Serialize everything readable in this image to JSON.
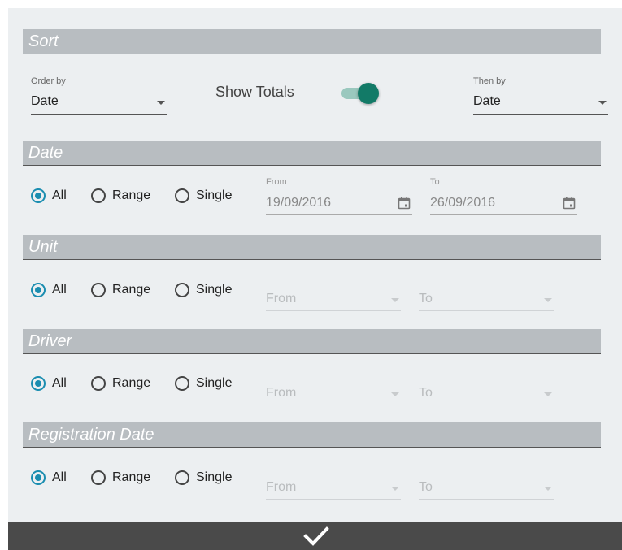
{
  "sort": {
    "header": "Sort",
    "order_by_label": "Order by",
    "order_by_value": "Date",
    "show_totals_label": "Show Totals",
    "show_totals_on": true,
    "then_by_label": "Then by",
    "then_by_value": "Date"
  },
  "date": {
    "header": "Date",
    "options": [
      "All",
      "Range",
      "Single"
    ],
    "selected": "All",
    "from_label": "From",
    "from_value": "19/09/2016",
    "to_label": "To",
    "to_value": "26/09/2016"
  },
  "unit": {
    "header": "Unit",
    "options": [
      "All",
      "Range",
      "Single"
    ],
    "selected": "All",
    "from_placeholder": "From",
    "to_placeholder": "To"
  },
  "driver": {
    "header": "Driver",
    "options": [
      "All",
      "Range",
      "Single"
    ],
    "selected": "All",
    "from_placeholder": "From",
    "to_placeholder": "To"
  },
  "registration_date": {
    "header": "Registration Date",
    "options": [
      "All",
      "Range",
      "Single"
    ],
    "selected": "All",
    "from_placeholder": "From",
    "to_placeholder": "To"
  },
  "footer": {
    "confirm_icon": "checkmark-icon"
  },
  "colors": {
    "accent": "#1a8db0",
    "toggle_on": "#127a67",
    "header_bg": "#b8bdc1",
    "footer_bg": "#4a4a4a"
  }
}
